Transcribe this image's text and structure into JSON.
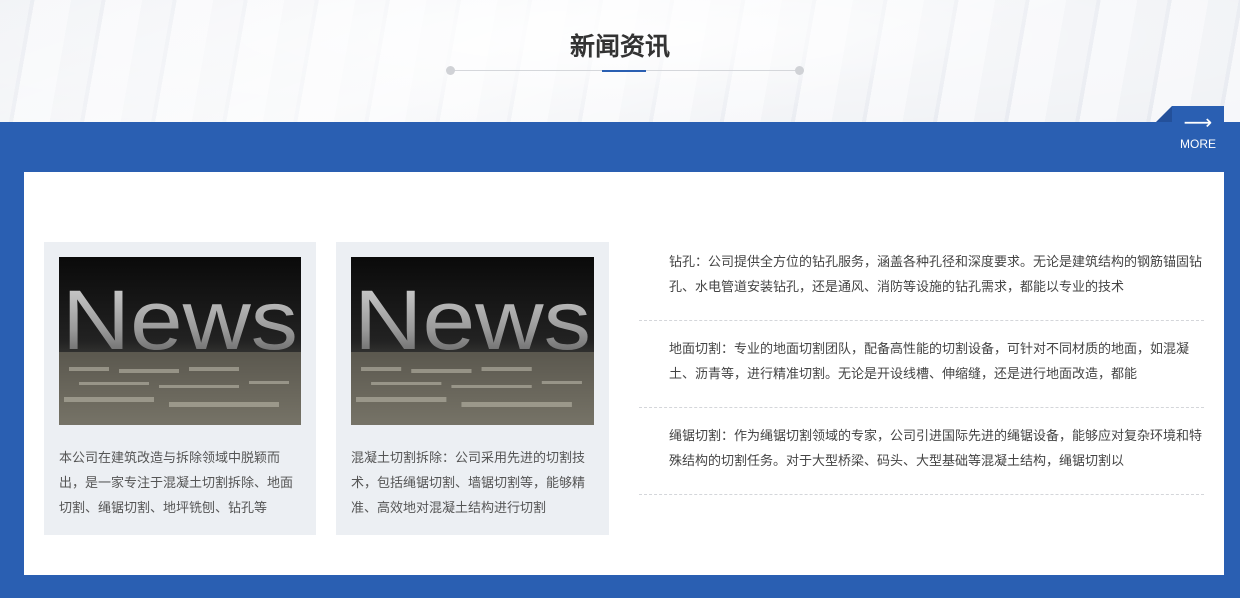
{
  "section": {
    "title": "新闻资讯",
    "more_label": "MORE",
    "more_arrow": "⟶"
  },
  "colors": {
    "brand_blue": "#2a5fb2",
    "card_bg": "#eceff3"
  },
  "cards": [
    {
      "image_text": "News",
      "description": "本公司在建筑改造与拆除领域中脱颖而出，是一家专注于混凝土切割拆除、地面切割、绳锯切割、地坪铣刨、钻孔等"
    },
    {
      "image_text": "News",
      "description": "混凝土切割拆除：公司采用先进的切割技术，包括绳锯切割、墙锯切割等，能够精准、高效地对混凝土结构进行切割"
    }
  ],
  "news": [
    {
      "text": "钻孔：公司提供全方位的钻孔服务，涵盖各种孔径和深度要求。无论是建筑结构的钢筋锚固钻孔、水电管道安装钻孔，还是通风、消防等设施的钻孔需求，都能以专业的技术"
    },
    {
      "text": "地面切割：专业的地面切割团队，配备高性能的切割设备，可针对不同材质的地面，如混凝土、沥青等，进行精准切割。无论是开设线槽、伸缩缝，还是进行地面改造，都能"
    },
    {
      "text": "绳锯切割：作为绳锯切割领域的专家，公司引进国际先进的绳锯设备，能够应对复杂环境和特殊结构的切割任务。对于大型桥梁、码头、大型基础等混凝土结构，绳锯切割以"
    }
  ]
}
